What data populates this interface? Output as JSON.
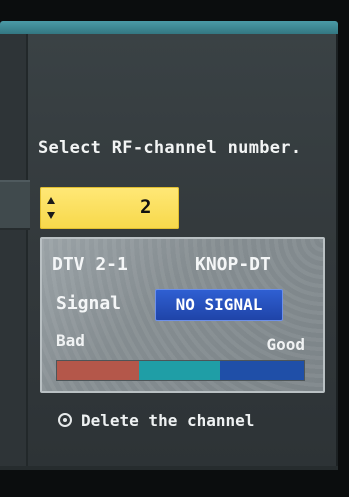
{
  "menu": {
    "instruction": "Select RF-channel number.",
    "channel_stepper": {
      "value": "2",
      "icon": "up-down-arrows-icon"
    },
    "info": {
      "channel_number": "DTV 2-1",
      "station_name": "KNOP-DT",
      "signal_label": "Signal",
      "signal_status": "NO SIGNAL",
      "scale_low_label": "Bad",
      "scale_high_label": "Good",
      "meter_colors": [
        "#b4574a",
        "#1f9ea6",
        "#1f4fa8"
      ]
    },
    "delete_action": {
      "label": "Delete the channel",
      "icon": "ok-button-icon"
    }
  },
  "colors": {
    "stepper_bg": "#f7d84a",
    "status_badge_bg": "#1f44a8",
    "panel_bg": "#33393c"
  }
}
